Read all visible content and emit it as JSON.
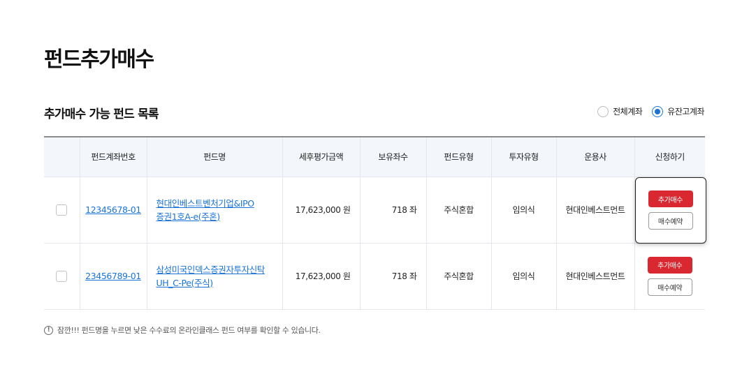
{
  "page": {
    "title": "펀드추가매수",
    "section_title": "추가매수 가능 펀드 목록"
  },
  "filter": {
    "options": [
      {
        "label": "전체계좌",
        "checked": false
      },
      {
        "label": "유잔고계좌",
        "checked": true
      }
    ]
  },
  "table": {
    "headers": [
      "",
      "펀드계좌번호",
      "펀드명",
      "세후평가금액",
      "보유좌수",
      "펀드유형",
      "투자유형",
      "운용사",
      "신청하기"
    ],
    "rows": [
      {
        "account": "12345678-01",
        "fund_name_line1": "현대인베스트벤처기업&IPO",
        "fund_name_line2": "증권1호A-e(주혼)",
        "amount": "17,623,000 원",
        "units": "718 좌",
        "fund_type": "주식혼합",
        "invest_type": "임의식",
        "manager": "현대인베스트먼트",
        "buy_label": "추가매수",
        "reserve_label": "매수예약"
      },
      {
        "account": "23456789-01",
        "fund_name_line1": "삼성미국인덱스증권자투자신탁",
        "fund_name_line2": "UH_C-Pe(주식)",
        "amount": "17,623,000 원",
        "units": "718 좌",
        "fund_type": "주식혼합",
        "invest_type": "임의식",
        "manager": "현대인베스트먼트",
        "buy_label": "추가매수",
        "reserve_label": "매수예약"
      }
    ]
  },
  "notice": {
    "icon": "info-icon",
    "glyph": "!",
    "text": "잠깐!!! 펀드명을 누르면 낮은 수수료의 온라인클래스 펀드 여부를 확인할 수 있습니다."
  },
  "colors": {
    "accent": "#1a73d9",
    "buy_button": "#d9282f",
    "header_bg": "#f3f7fb"
  }
}
